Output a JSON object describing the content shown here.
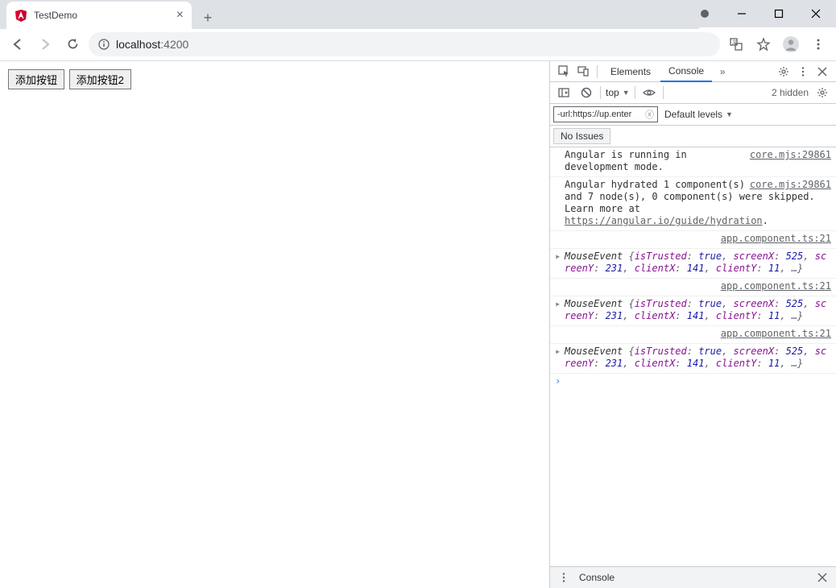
{
  "window": {
    "tab_title": "TestDemo",
    "url_host": "localhost",
    "url_port": ":4200"
  },
  "page": {
    "button1": "添加按钮",
    "button2": "添加按钮2"
  },
  "devtools": {
    "tabs": {
      "elements": "Elements",
      "console": "Console"
    },
    "toolbar": {
      "context": "top",
      "hidden": "2 hidden"
    },
    "filter": {
      "value": "-url:https://up.enter",
      "levels": "Default levels"
    },
    "issues": {
      "label": "No Issues"
    },
    "logs": [
      {
        "type": "text",
        "src": "core.mjs:29861",
        "msg": "Angular is running in development mode."
      },
      {
        "type": "html",
        "src": "core.mjs:29861",
        "msg": "Angular hydrated 1 component(s) and 7 node(s), 0 component(s) were skipped. Learn more at ",
        "link": "https://angular.io/guide/hydration"
      }
    ],
    "mouse_events": [
      {
        "src": "app.component.ts:21",
        "isTrusted": "true",
        "screenX": "525",
        "screenY": "231",
        "clientX": "141",
        "clientY": "11"
      },
      {
        "src": "app.component.ts:21",
        "isTrusted": "true",
        "screenX": "525",
        "screenY": "231",
        "clientX": "141",
        "clientY": "11"
      },
      {
        "src": "app.component.ts:21",
        "isTrusted": "true",
        "screenX": "525",
        "screenY": "231",
        "clientX": "141",
        "clientY": "11"
      }
    ],
    "drawer": {
      "label": "Console"
    }
  }
}
